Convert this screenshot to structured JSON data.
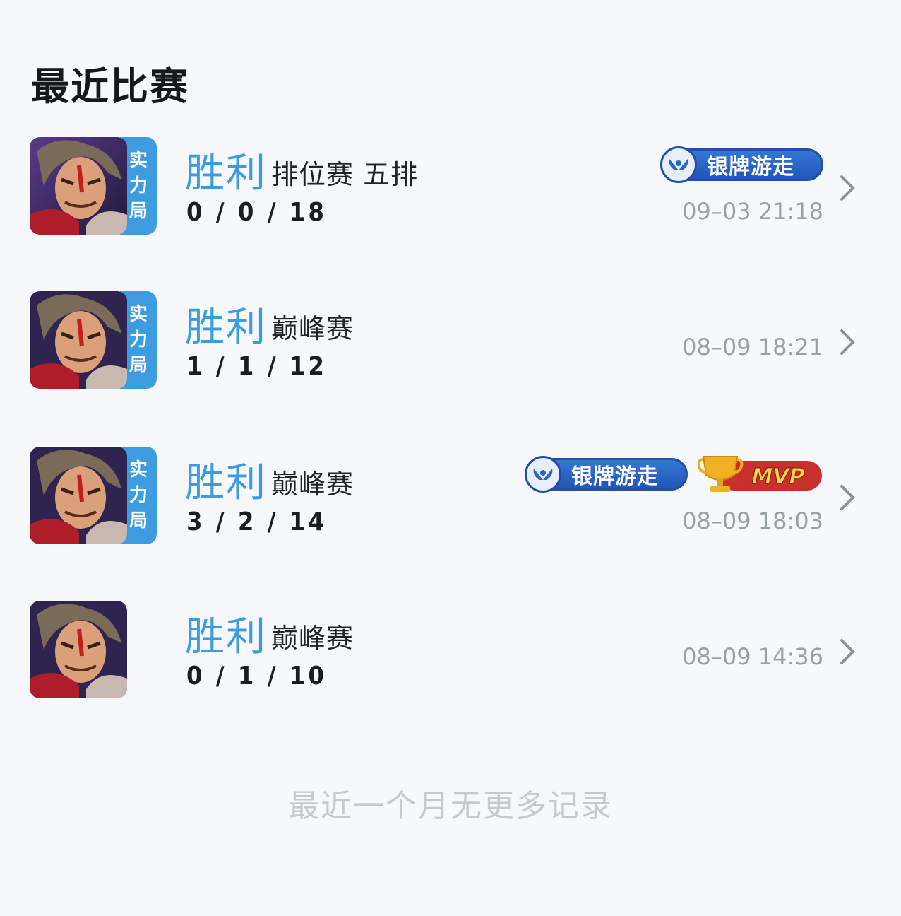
{
  "page": {
    "title": "最近比赛"
  },
  "matches": [
    {
      "tag": [
        "实",
        "力",
        "局"
      ],
      "result": "胜利",
      "mode": "排位赛 五排",
      "kda": "0 / 0 / 18",
      "badges": [
        "银牌游走"
      ],
      "time": "09–03 21:18"
    },
    {
      "tag": [
        "实",
        "力",
        "局"
      ],
      "result": "胜利",
      "mode": "巅峰赛",
      "kda": "1 / 1 / 12",
      "badges": [],
      "time": "08–09 18:21"
    },
    {
      "tag": [
        "实",
        "力",
        "局"
      ],
      "result": "胜利",
      "mode": "巅峰赛",
      "kda": "3 / 2 / 14",
      "badges": [
        "银牌游走",
        "MVP"
      ],
      "time": "08–09 18:03"
    },
    {
      "tag": [],
      "result": "胜利",
      "mode": "巅峰赛",
      "kda": "0 / 1 / 10",
      "badges": [],
      "time": "08–09 14:36"
    }
  ],
  "footer": "最近一个月无更多记录",
  "colors": {
    "accent": "#3d9be0",
    "badge_blue": "#2a66c8",
    "mvp_red": "#c9302c",
    "mvp_gold": "#f2b125"
  },
  "icons": {
    "avatar": "hero-portrait-icon",
    "chevron": "chevron-right-icon",
    "silver": "silver-wings-icon",
    "mvp": "trophy-icon"
  }
}
